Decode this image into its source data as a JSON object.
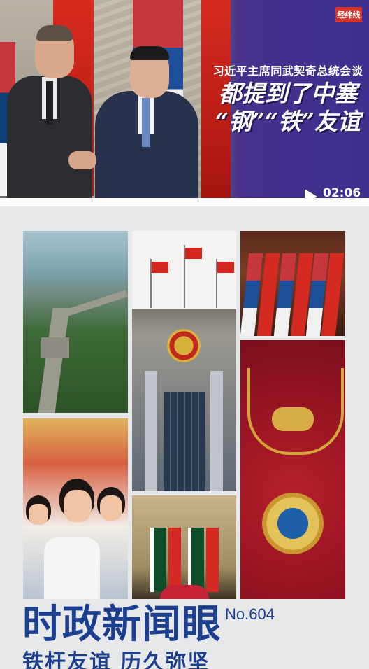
{
  "video": {
    "brand_logo": "经纬线",
    "subtitle": "习近平主席同武契奇总统会谈",
    "headline": "都提到了中塞\n“钢”“铁”友谊",
    "duration": "02:06"
  },
  "poster": {
    "title": "时政新闻眼",
    "issue": "No.604",
    "subtitle": "铁杆友谊 历久弥坚"
  },
  "colors": {
    "title_blue": "#1d3f8f",
    "china_red": "#d52a22",
    "serbia_blue": "#0c4076",
    "poster_bg": "#e7e8ea"
  }
}
